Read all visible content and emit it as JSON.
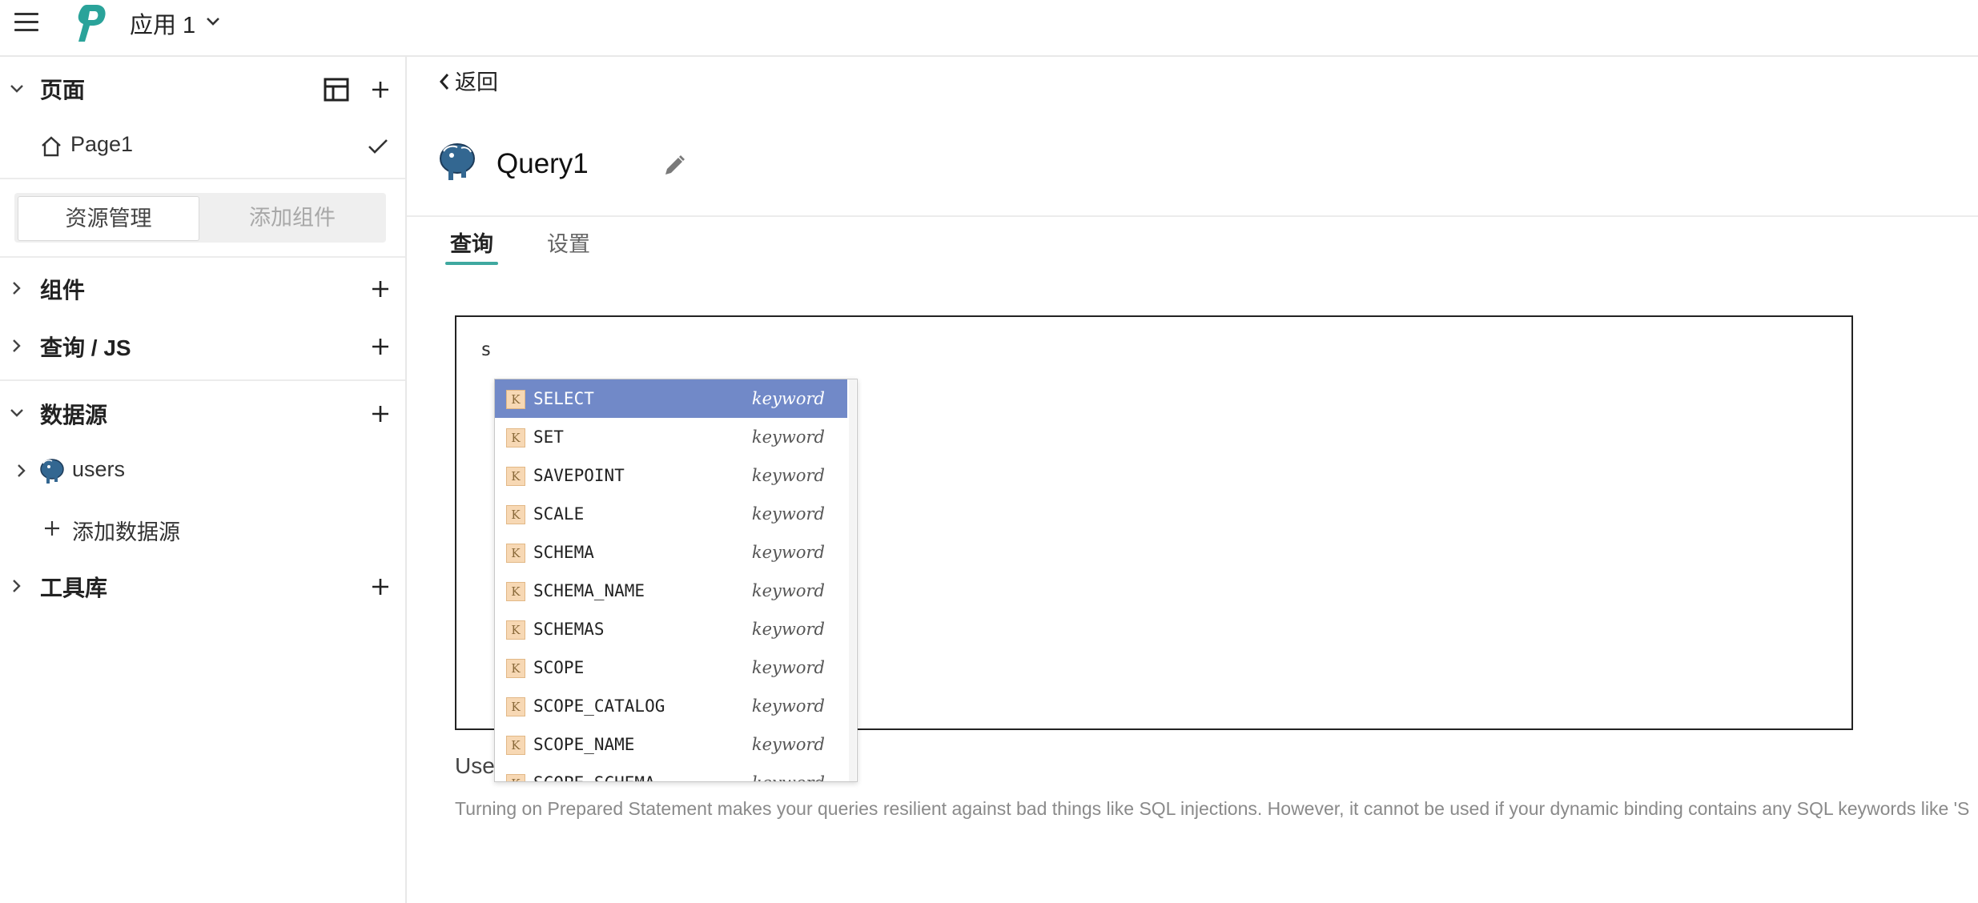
{
  "app": {
    "name": "应用 1"
  },
  "sidebar": {
    "pages": {
      "title": "页面",
      "items": [
        {
          "label": "Page1"
        }
      ]
    },
    "segmented": {
      "active": "资源管理",
      "inactive": "添加组件"
    },
    "components": {
      "title": "组件"
    },
    "queries": {
      "title": "查询 / JS"
    },
    "datasources": {
      "title": "数据源",
      "items": [
        {
          "label": "users"
        }
      ],
      "add_label": "添加数据源"
    },
    "libraries": {
      "title": "工具库"
    }
  },
  "main": {
    "back_label": "返回",
    "query_name": "Query1",
    "tabs": [
      {
        "label": "查询"
      },
      {
        "label": "设置"
      }
    ],
    "editor_text": "s",
    "autocomplete": [
      {
        "kind": "K",
        "label": "SELECT",
        "type": "keyword"
      },
      {
        "kind": "K",
        "label": "SET",
        "type": "keyword"
      },
      {
        "kind": "K",
        "label": "SAVEPOINT",
        "type": "keyword"
      },
      {
        "kind": "K",
        "label": "SCALE",
        "type": "keyword"
      },
      {
        "kind": "K",
        "label": "SCHEMA",
        "type": "keyword"
      },
      {
        "kind": "K",
        "label": "SCHEMA_NAME",
        "type": "keyword"
      },
      {
        "kind": "K",
        "label": "SCHEMAS",
        "type": "keyword"
      },
      {
        "kind": "K",
        "label": "SCOPE",
        "type": "keyword"
      },
      {
        "kind": "K",
        "label": "SCOPE_CATALOG",
        "type": "keyword"
      },
      {
        "kind": "K",
        "label": "SCOPE_NAME",
        "type": "keyword"
      },
      {
        "kind": "K",
        "label": "SCOPE_SCHEMA",
        "type": "keyword"
      }
    ],
    "use_label": "Use",
    "hint_text": "Turning on Prepared Statement makes your queries resilient against bad things like SQL injections. However, it cannot be used if your dynamic binding contains any SQL keywords like 'S"
  },
  "colors": {
    "accent": "#3fa8a0",
    "selection": "#7189c8",
    "logo": "#2aa39a"
  },
  "icons": [
    "menu-icon",
    "logo-icon",
    "chevron-down-icon",
    "layout-icon",
    "plus-icon",
    "home-icon",
    "check-icon",
    "chevron-right-icon",
    "postgres-icon",
    "edit-icon",
    "chevron-left-icon"
  ]
}
